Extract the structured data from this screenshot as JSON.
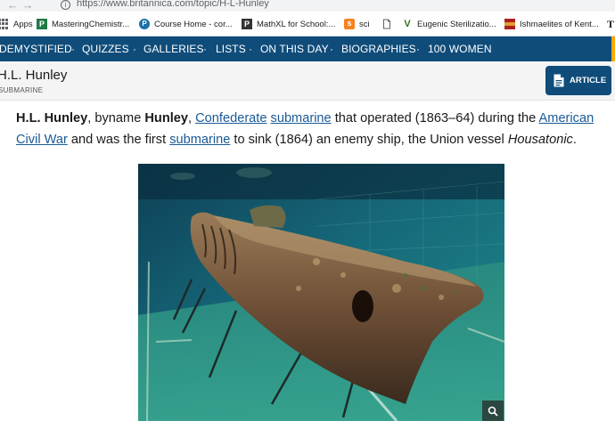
{
  "browser": {
    "nav_arrows": "← →",
    "info_glyph": "i",
    "url": "https://www.britannica.com/topic/H-L-Hunley"
  },
  "bookmarks": [
    {
      "label": "Apps",
      "icon": "apps-grid-icon"
    },
    {
      "label": "MasteringChemistr...",
      "icon": "mastering-icon",
      "color": "#1f7a45",
      "glyph": "P"
    },
    {
      "label": "Course Home - cor...",
      "icon": "pearson-icon",
      "color": "#1b6fa8",
      "glyph": "P"
    },
    {
      "label": "MathXL for School:...",
      "icon": "mathxl-icon",
      "color": "#333333",
      "glyph": "P"
    },
    {
      "label": "sci",
      "icon": "sci-icon",
      "color": "#f58220",
      "glyph": "s"
    },
    {
      "label": "",
      "icon": "blank-page-icon"
    },
    {
      "label": "Eugenic Sterilizatio...",
      "icon": "eugenic-icon",
      "color": "#3a6b1f",
      "glyph": "V"
    },
    {
      "label": "Ishmaelites of Kent...",
      "icon": "ishmaelites-icon",
      "color": "#b01e1e"
    },
    {
      "label": "T",
      "icon": "nyt-icon"
    }
  ],
  "topnav": {
    "items": [
      "DEMYSTIFIED",
      "QUIZZES",
      "GALLERIES",
      "LISTS",
      "ON THIS DAY",
      "BIOGRAPHIES",
      "100 WOMEN"
    ],
    "separator": "·"
  },
  "titlebar": {
    "title": "H.L. Hunley",
    "subtitle": "SUBMARINE",
    "article_button": "ARTICLE"
  },
  "lead": {
    "name_bold": "H.L. Hunley",
    "t1": ", byname ",
    "byname_bold": "Hunley",
    "t2": ", ",
    "link_confederate": "Confederate",
    "t3": " ",
    "link_submarine1": "submarine",
    "t4": " that operated (1863–64) during the ",
    "link_civil_war": "American Civil War",
    "t5": " and was the first ",
    "link_submarine2": "submarine",
    "t6": " to sink (1864) an enemy ship, the Union vessel ",
    "vessel_italic": "Housatonic",
    "t7": "."
  },
  "colors": {
    "nav_bg": "#0f4c7a",
    "link": "#1a5a96",
    "accent": "#ffa800"
  }
}
